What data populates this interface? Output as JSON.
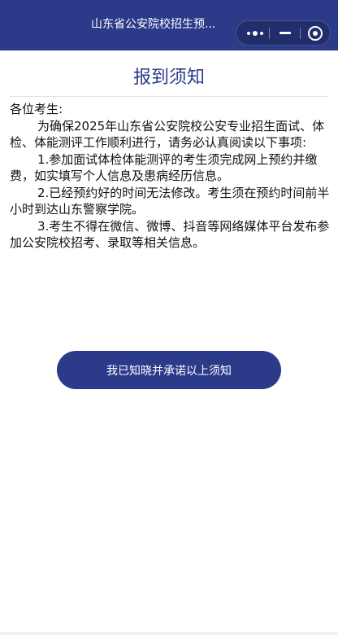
{
  "nav": {
    "title": "山东省公安院校招生预..."
  },
  "page": {
    "heading": "报到须知",
    "greeting": "各位考生:",
    "paragraphs": [
      "为确保2025年山东省公安院校公安专业招生面试、体检、体能测评工作顺利进行，请务必认真阅读以下事项:",
      "1.参加面试体检体能测评的考生须完成网上预约并缴费，如实填写个人信息及患病经历信息。",
      "2.已经预约好的时间无法修改。考生须在预约时间前半小时到达山东警察学院。",
      "3.考生不得在微信、微博、抖音等网络媒体平台发布参加公安院校招考、录取等相关信息。"
    ],
    "confirm_label": "我已知晓并承诺以上须知"
  },
  "colors": {
    "brand": "#2c3a8a",
    "text": "#111111",
    "background": "#ffffff"
  }
}
